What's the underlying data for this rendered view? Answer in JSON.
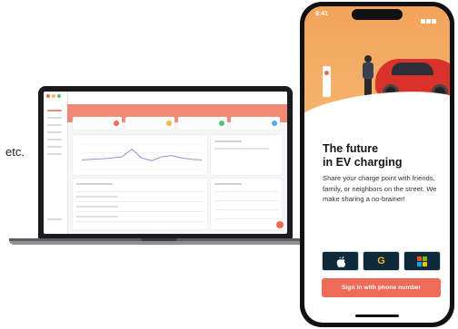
{
  "caption": {
    "etc": "etc."
  },
  "phone": {
    "status_time": "9:41",
    "headline_line1": "The future",
    "headline_line2": "in EV charging",
    "description": "Share your charge point with friends, family, or neighbors on the street. We make sharing a no-brainer!",
    "sso_buttons": [
      {
        "icon": "apple-icon"
      },
      {
        "icon": "google-icon",
        "glyph": "G"
      },
      {
        "icon": "microsoft-icon"
      }
    ],
    "cta_label": "Sign in with phone number"
  },
  "colors": {
    "accent": "#ef6a57",
    "hero": "#f6a55e",
    "sso_bg": "#0e2a3a",
    "car": "#d8322a"
  },
  "chart_data": {
    "type": "line",
    "series": [
      {
        "values": [
          0.62,
          0.6,
          0.58,
          0.55,
          0.5,
          0.2,
          0.55,
          0.65,
          0.5,
          0.45,
          0.55,
          0.6,
          0.62
        ]
      }
    ]
  }
}
